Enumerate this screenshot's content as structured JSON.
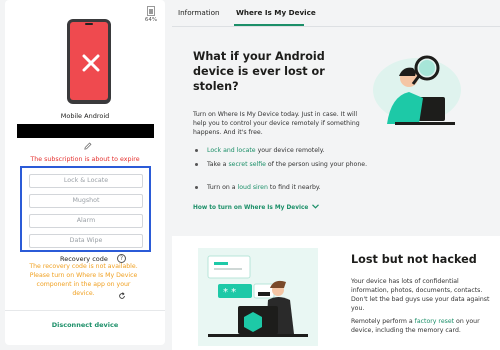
{
  "device_card": {
    "battery_pct": "64%",
    "device_name": "Mobile Android",
    "subscription_warning": "The subscription is about to expire",
    "actions": [
      "Lock & Locate",
      "Mugshot",
      "Alarm",
      "Data Wipe"
    ],
    "recovery_label": "Recovery code",
    "recovery_text": "The recovery code is not available. Please turn on Where Is My Device component in the app on your device.",
    "disconnect_label": "Disconnect device"
  },
  "tabs": [
    "Information",
    "Where Is My Device"
  ],
  "where_panel": {
    "title": "What if your Android device is ever lost or stolen?",
    "intro": "Turn on Where Is My Device today. Just in case. It will help you to control your device remotely if something happens. And it's free.",
    "bullets": [
      {
        "link": "Lock and locate",
        "rest": " your device remotely."
      },
      {
        "pre": "Take a ",
        "link": "secret selfie",
        "rest": " of the person using your phone."
      },
      {
        "pre": "Turn on a ",
        "link": "loud siren",
        "rest": " to find it nearby."
      }
    ],
    "howto": "How to turn on Where Is My Device"
  },
  "lost_panel": {
    "title": "Lost but not hacked",
    "p1": "Your device has lots of confidential information, photos, documents, contacts. Don't let the bad guys use your data against you.",
    "p2_pre": "Remotely perform a ",
    "p2_link": "factory reset",
    "p2_rest": " on your device, including the memory card."
  },
  "colors": {
    "accent": "#1b8f68",
    "warning_red": "#e5312f",
    "warning_orange": "#f0a020",
    "highlight_blue": "#2b5bd7",
    "phone_screen": "#ef4a4f"
  },
  "icons": [
    "battery-icon",
    "phone-x-icon",
    "edit-pencil-icon",
    "help-icon",
    "refresh-icon",
    "chevron-down-icon"
  ]
}
